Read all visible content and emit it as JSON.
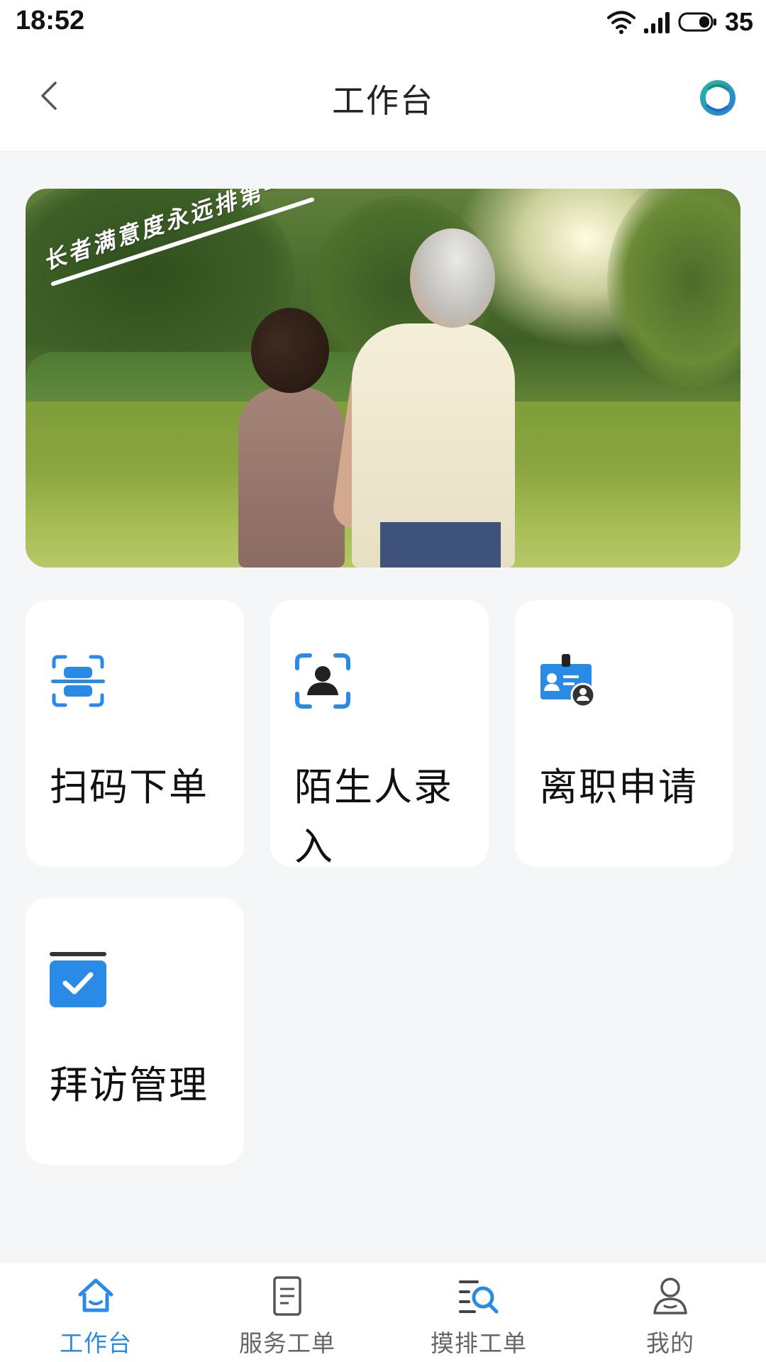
{
  "status_bar": {
    "time": "18:52",
    "battery": "35",
    "icons": [
      "wifi-icon",
      "signal-icon",
      "battery-icon"
    ]
  },
  "header": {
    "title": "工作台",
    "back_icon": "chevron-left-icon",
    "logo_icon": "app-logo-icon"
  },
  "banner": {
    "slogan": "长者满意度永远排第一"
  },
  "cards": [
    {
      "label": "扫码下单",
      "icon": "scan-icon",
      "color": "#2a8be6"
    },
    {
      "label": "陌生人录入",
      "icon": "face-scan-icon",
      "color": "#2a8be6"
    },
    {
      "label": "离职申请",
      "icon": "id-card-icon",
      "color": "#2a8be6"
    },
    {
      "label": "拜访管理",
      "icon": "checklist-icon",
      "color": "#2a8be6"
    }
  ],
  "bottom_nav": {
    "items": [
      {
        "label": "工作台",
        "icon": "home-icon",
        "active": true
      },
      {
        "label": "服务工单",
        "icon": "document-icon",
        "active": false
      },
      {
        "label": "摸排工单",
        "icon": "search-list-icon",
        "active": false
      },
      {
        "label": "我的",
        "icon": "user-icon",
        "active": false
      }
    ]
  },
  "colors": {
    "accent": "#2a8be6",
    "background": "#f5f6f8",
    "card": "#ffffff"
  }
}
